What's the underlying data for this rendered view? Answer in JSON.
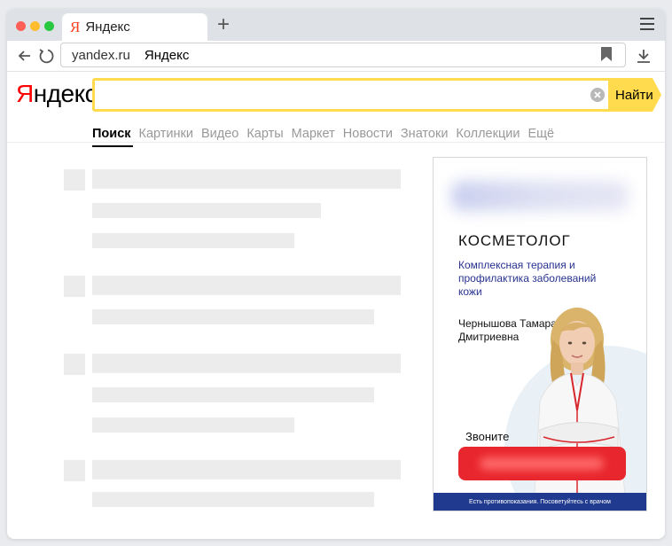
{
  "browser": {
    "tab_title": "Яндекс",
    "tab_favicon": "Я",
    "new_tab": "+",
    "url_host": "yandex.ru",
    "url_title": "Яндекс"
  },
  "yandex": {
    "logo_first": "Я",
    "logo_rest": "ндекс",
    "search_value": "",
    "search_button": "Найти",
    "services": [
      {
        "label": "Поиск",
        "active": true
      },
      {
        "label": "Картинки"
      },
      {
        "label": "Видео"
      },
      {
        "label": "Карты"
      },
      {
        "label": "Маркет"
      },
      {
        "label": "Новости"
      },
      {
        "label": "Знатоки"
      },
      {
        "label": "Коллекции"
      },
      {
        "label": "Ещё"
      }
    ]
  },
  "ad": {
    "title": "КОСМЕТОЛОГ",
    "subtitle": "Комплексная терапия и профилактика заболеваний кожи",
    "doctor_name": "Чернышова Тамара Дмитриевна",
    "call_label": "Звоните",
    "footer": "Есть противопоказания. Посоветуйтесь с врачом"
  },
  "colors": {
    "search_accent": "#ffdb4d",
    "logo_red": "#ff0000",
    "ad_button": "#e8262d",
    "ad_footer": "#1f3a8f",
    "ad_text_blue": "#27328f"
  }
}
